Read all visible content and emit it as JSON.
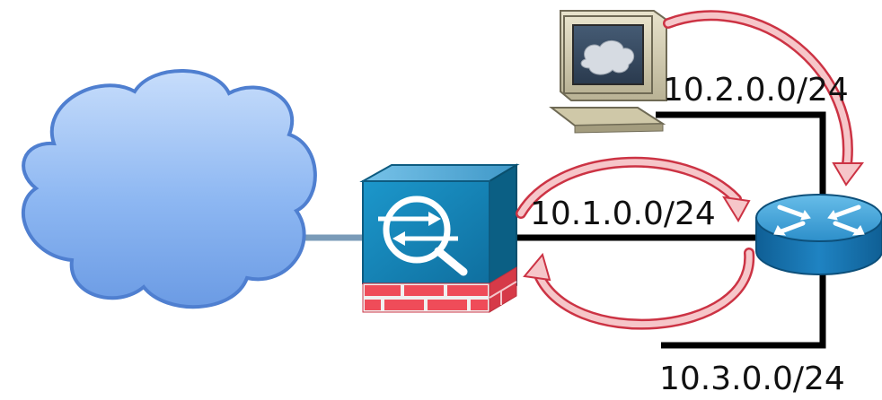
{
  "diagram": {
    "labels": {
      "subnet_top": "10.2.0.0/24",
      "subnet_middle": "10.1.0.0/24",
      "subnet_bottom": "10.3.0.0/24"
    },
    "nodes": {
      "internet": "cloud-icon",
      "firewall": "firewall-icon",
      "router": "router-icon",
      "workstation": "workstation-icon"
    },
    "colors": {
      "cloud_fill": "#79a6e9",
      "cloud_stroke": "#4d7ccf",
      "firewall_face": "#1680b1",
      "firewall_top": "#4fa6d3",
      "firewall_side": "#0b5f84",
      "brick": "#ef4c59",
      "router_body": "#1b75b0",
      "router_top": "#49a5db",
      "arrow_outline": "#cc3344",
      "arrow_fill": "#f6c6c9",
      "wire": "#000000"
    }
  }
}
